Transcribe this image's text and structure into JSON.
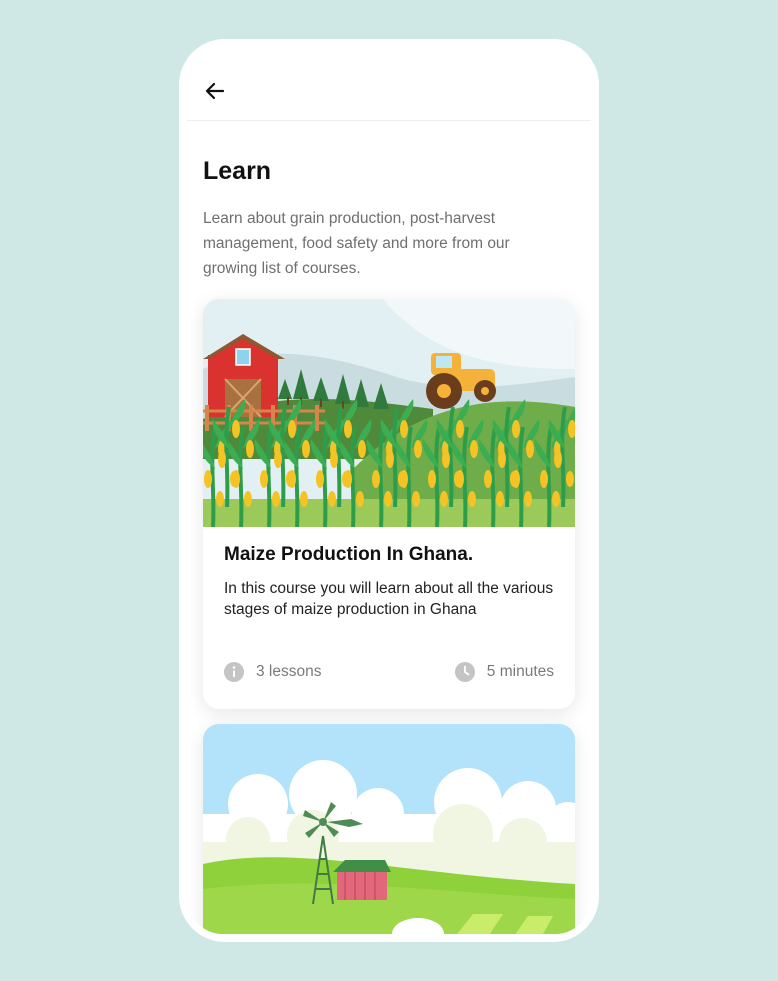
{
  "header": {
    "back_label": "Back"
  },
  "page": {
    "title": "Learn",
    "intro": "Learn about grain production, post-harvest management, food safety and more from our growing list of courses."
  },
  "courses": [
    {
      "title": "Maize Production In Ghana.",
      "description": "In this course you will learn about all the various stages of maize production in Ghana",
      "lessons": "3 lessons",
      "duration": "5 minutes",
      "image": "farm-maize-field-illustration"
    },
    {
      "image": "farm-windmill-illustration"
    }
  ],
  "colors": {
    "background": "#cfe8e6",
    "card": "#ffffff",
    "meta_icon": "#c4c4c4"
  }
}
